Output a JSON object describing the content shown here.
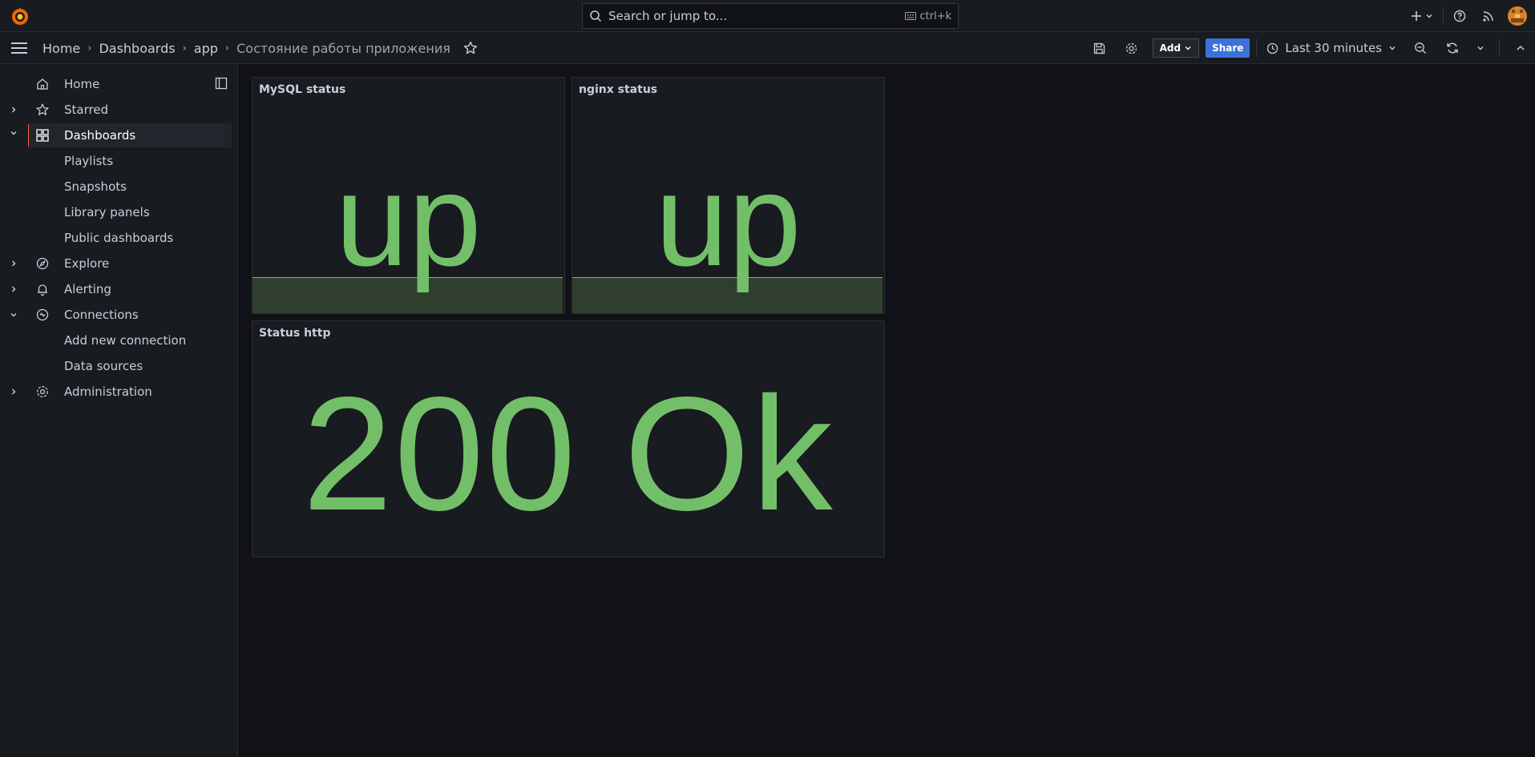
{
  "topbar": {
    "search_placeholder": "Search or jump to...",
    "search_shortcut": "ctrl+k"
  },
  "breadcrumb": {
    "items": [
      "Home",
      "Dashboards",
      "app",
      "Состояние работы приложения"
    ]
  },
  "toolbar": {
    "add_label": "Add",
    "share_label": "Share",
    "time_range": "Last 30 minutes"
  },
  "sidebar": {
    "items": [
      {
        "label": "Home",
        "icon": "home-icon"
      },
      {
        "label": "Starred",
        "icon": "star-icon"
      },
      {
        "label": "Dashboards",
        "icon": "apps-icon",
        "active": true
      },
      {
        "label": "Playlists"
      },
      {
        "label": "Snapshots"
      },
      {
        "label": "Library panels"
      },
      {
        "label": "Public dashboards"
      },
      {
        "label": "Explore",
        "icon": "compass-icon"
      },
      {
        "label": "Alerting",
        "icon": "bell-icon"
      },
      {
        "label": "Connections",
        "icon": "link-icon"
      },
      {
        "label": "Add new connection"
      },
      {
        "label": "Data sources"
      },
      {
        "label": "Administration",
        "icon": "cog-icon"
      }
    ]
  },
  "panels": [
    {
      "title": "MySQL status",
      "value": "up"
    },
    {
      "title": "nginx status",
      "value": "up"
    },
    {
      "title": "Status http",
      "value": "200 Ok"
    }
  ],
  "colors": {
    "value_green": "#73bf69",
    "accent_orange": "#f55f3e",
    "primary_blue": "#3d71d9"
  }
}
